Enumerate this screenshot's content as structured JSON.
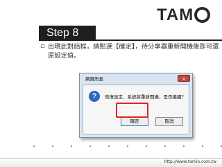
{
  "logo": {
    "text_pre": "TAM",
    "text_post": "IO"
  },
  "slide": {
    "title": "Step 8",
    "bullet_text": "出現此對話框，請點選【確定】，待分享器重新開機後即可還原設定值。"
  },
  "dialog": {
    "title": "網頁訊息",
    "close_glyph": "×",
    "message": "恢復設定，系統將重新開機，是否繼續？",
    "ok_label": "確定",
    "cancel_label": "取消",
    "icon": "question-icon"
  },
  "footer": {
    "url": "http://www.tamio.com.tw"
  },
  "colors": {
    "highlight": "#e22222",
    "title_bg": "#1f1f1f"
  }
}
